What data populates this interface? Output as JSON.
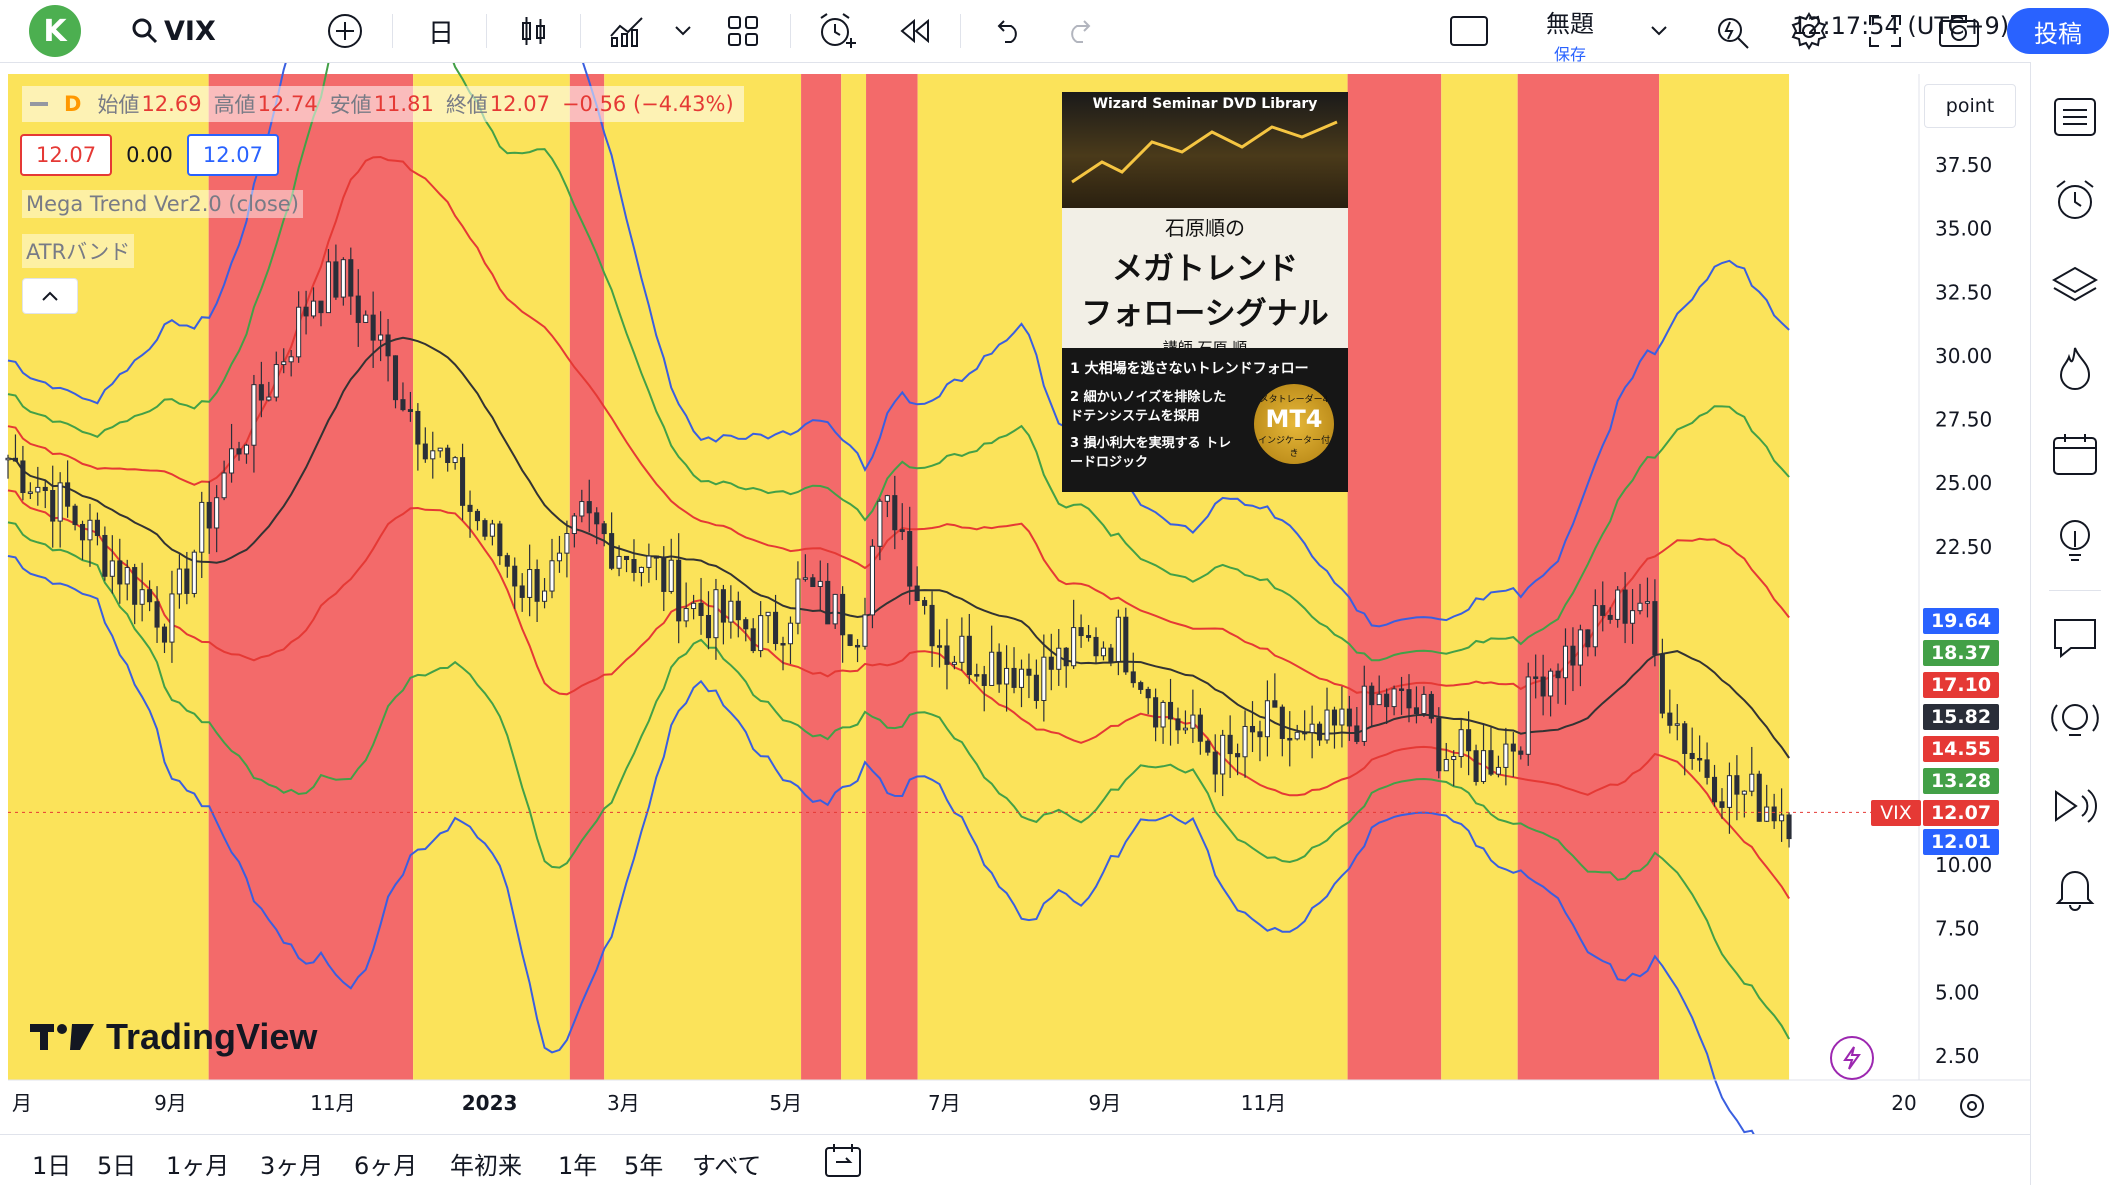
{
  "toolbar": {
    "avatar_letter": "K",
    "symbol": "VIX",
    "interval": "日",
    "layout_title": "無題",
    "layout_saved": "保存",
    "publish": "投稿"
  },
  "legend": {
    "interval_code": "D",
    "open_label": "始値",
    "open": "12.69",
    "high_label": "高値",
    "high": "12.74",
    "low_label": "安値",
    "low": "11.81",
    "close_label": "終値",
    "close": "12.07",
    "change": "−0.56 (−4.43%)",
    "value_left": "12.07",
    "value_mid": "0.00",
    "value_right": "12.07",
    "indicator1": "Mega Trend Ver2.0 (close)",
    "indicator2": "ATRバンド"
  },
  "ad": {
    "brand": "Wizard Seminar DVD Library",
    "subtitle": "石原順の",
    "title_line1": "メガトレンド",
    "title_line2": "フォローシグナル",
    "author": "講師 石原 順",
    "points": [
      {
        "num": "1",
        "text": "大相場を逃さないトレンドフォロー"
      },
      {
        "num": "2",
        "text": "細かいノイズを排除した ドテンシステムを採用"
      },
      {
        "num": "3",
        "text": "損小利大を実現する トレードロジック"
      }
    ],
    "badge_top": "メタトレーダー4",
    "badge_main": "MT4",
    "badge_bottom": "インジケーター付き"
  },
  "price_axis": {
    "unit_button": "point",
    "ticks": [
      "37.50",
      "35.00",
      "32.50",
      "30.00",
      "27.50",
      "25.00",
      "22.50",
      "10.00",
      "7.50",
      "5.00",
      "2.50"
    ]
  },
  "price_labels": [
    {
      "value": "19.64",
      "color": "#2962ff"
    },
    {
      "value": "18.37",
      "color": "#43a047"
    },
    {
      "value": "17.10",
      "color": "#e53935"
    },
    {
      "value": "15.82",
      "color": "#2a2e39"
    },
    {
      "value": "14.55",
      "color": "#e53935"
    },
    {
      "value": "13.28",
      "color": "#43a047"
    },
    {
      "value": "12.07",
      "color": "#e53935",
      "tag": "VIX"
    },
    {
      "value": "12.01",
      "color": "#2962ff"
    }
  ],
  "time_axis": [
    "月",
    "9月",
    "11月",
    "2023",
    "3月",
    "5月",
    "7月",
    "9月",
    "11月",
    "20"
  ],
  "ranges": [
    "1日",
    "5日",
    "1ヶ月",
    "3ヶ月",
    "6ヶ月",
    "年初来",
    "1年",
    "5年",
    "すべて"
  ],
  "clock": "12:17:54 (UTC+9)",
  "watermark": "TradingView",
  "colors": {
    "bull_zone": "#fbe35a",
    "bear_zone": "#f36a6a",
    "accent": "#2962ff",
    "band_outer": "#3a5fe0",
    "band_mid": "#43a047",
    "band_inner": "#e53935",
    "center_line": "#333333"
  },
  "chart_data": {
    "type": "candlestick",
    "symbol": "VIX",
    "ylim": [
      2.5,
      38.5
    ],
    "zones": [
      {
        "start": 0.0,
        "end": 0.105,
        "state": "bull"
      },
      {
        "start": 0.105,
        "end": 0.212,
        "state": "bear"
      },
      {
        "start": 0.212,
        "end": 0.294,
        "state": "bull"
      },
      {
        "start": 0.294,
        "end": 0.312,
        "state": "bear"
      },
      {
        "start": 0.312,
        "end": 0.415,
        "state": "bull"
      },
      {
        "start": 0.415,
        "end": 0.436,
        "state": "bear"
      },
      {
        "start": 0.436,
        "end": 0.449,
        "state": "bull"
      },
      {
        "start": 0.449,
        "end": 0.476,
        "state": "bear"
      },
      {
        "start": 0.476,
        "end": 0.701,
        "state": "bull"
      },
      {
        "start": 0.701,
        "end": 0.75,
        "state": "bear"
      },
      {
        "start": 0.75,
        "end": 0.79,
        "state": "bull"
      },
      {
        "start": 0.79,
        "end": 0.864,
        "state": "bear"
      },
      {
        "start": 0.864,
        "end": 0.932,
        "state": "bull"
      }
    ],
    "close_path": [
      [
        0.0,
        26.0
      ],
      [
        0.03,
        24.0
      ],
      [
        0.06,
        21.5
      ],
      [
        0.085,
        19.5
      ],
      [
        0.1,
        23.0
      ],
      [
        0.12,
        26.5
      ],
      [
        0.14,
        29.5
      ],
      [
        0.16,
        32.5
      ],
      [
        0.175,
        33.0
      ],
      [
        0.19,
        31.0
      ],
      [
        0.21,
        28.0
      ],
      [
        0.23,
        25.5
      ],
      [
        0.25,
        23.0
      ],
      [
        0.27,
        21.0
      ],
      [
        0.29,
        21.5
      ],
      [
        0.3,
        23.5
      ],
      [
        0.32,
        22.5
      ],
      [
        0.34,
        21.5
      ],
      [
        0.36,
        20.0
      ],
      [
        0.38,
        19.5
      ],
      [
        0.4,
        19.0
      ],
      [
        0.415,
        21.0
      ],
      [
        0.43,
        20.0
      ],
      [
        0.445,
        19.5
      ],
      [
        0.455,
        23.5
      ],
      [
        0.465,
        24.0
      ],
      [
        0.475,
        21.0
      ],
      [
        0.49,
        18.5
      ],
      [
        0.52,
        18.0
      ],
      [
        0.54,
        17.5
      ],
      [
        0.56,
        18.5
      ],
      [
        0.58,
        19.0
      ],
      [
        0.59,
        18.0
      ],
      [
        0.6,
        16.5
      ],
      [
        0.62,
        15.0
      ],
      [
        0.64,
        14.0
      ],
      [
        0.66,
        15.5
      ],
      [
        0.68,
        14.5
      ],
      [
        0.7,
        15.5
      ],
      [
        0.72,
        16.5
      ],
      [
        0.74,
        16.0
      ],
      [
        0.75,
        14.5
      ],
      [
        0.77,
        14.0
      ],
      [
        0.79,
        15.0
      ],
      [
        0.8,
        17.5
      ],
      [
        0.82,
        18.5
      ],
      [
        0.84,
        20.0
      ],
      [
        0.855,
        20.5
      ],
      [
        0.865,
        17.0
      ],
      [
        0.88,
        14.5
      ],
      [
        0.9,
        13.0
      ],
      [
        0.92,
        12.5
      ],
      [
        0.932,
        12.07
      ]
    ],
    "last": {
      "open": 12.69,
      "high": 12.74,
      "low": 11.81,
      "close": 12.07
    }
  }
}
